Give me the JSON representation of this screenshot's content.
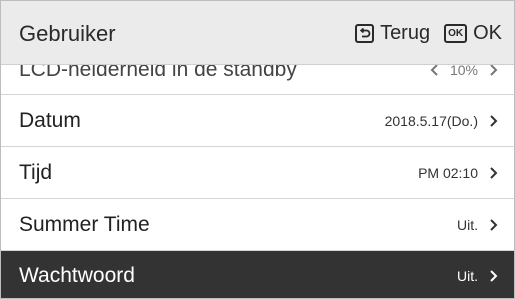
{
  "header": {
    "title": "Gebruiker",
    "back_label": "Terug",
    "ok_badge": "OK",
    "ok_label": "OK"
  },
  "menu": {
    "items": [
      {
        "label": "LCD-helderheid in de standby",
        "value": "10%",
        "selected": false,
        "partial": true
      },
      {
        "label": "Datum",
        "value": "2018.5.17(Do.)",
        "selected": false
      },
      {
        "label": "Tijd",
        "value": "PM 02:10",
        "selected": false
      },
      {
        "label": "Summer Time",
        "value": "Uit.",
        "selected": false
      },
      {
        "label": "Wachtwoord",
        "value": "Uit.",
        "selected": true
      }
    ]
  },
  "colors": {
    "header_bg": "#ebebeb",
    "selected_bg": "#333333",
    "text": "#222222"
  }
}
